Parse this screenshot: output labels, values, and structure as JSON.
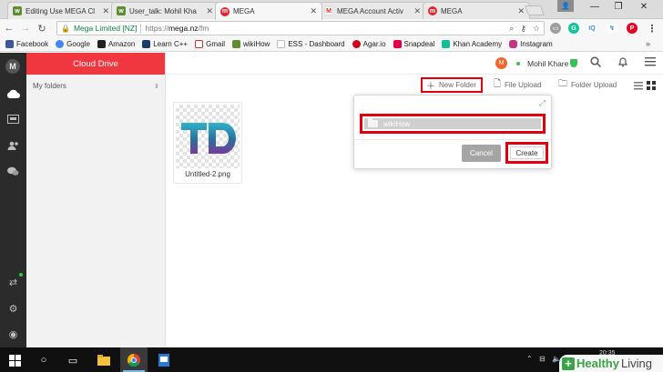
{
  "tabs": [
    {
      "title": "Editing Use MEGA Cl",
      "icon": "wikihow-icon"
    },
    {
      "title": "User_talk: Mohil Kha",
      "icon": "wikihow-icon"
    },
    {
      "title": "MEGA",
      "icon": "mega-icon"
    },
    {
      "title": "MEGA Account Activ",
      "icon": "gmail-icon"
    },
    {
      "title": "MEGA",
      "icon": "mega-icon"
    }
  ],
  "address": {
    "secure_label": "Mega Limited [NZ]",
    "url_prefix": "https://",
    "url_host": "mega.nz",
    "url_path": "/fm"
  },
  "bookmarks": [
    {
      "label": "Facebook",
      "color": "#3b5998"
    },
    {
      "label": "Google",
      "color": "#4285f4"
    },
    {
      "label": "Amazon",
      "color": "#222222"
    },
    {
      "label": "Learn C++",
      "color": "#1f3a6e"
    },
    {
      "label": "Gmail",
      "color": "#d93025"
    },
    {
      "label": "wikiHow",
      "color": "#5e8c31"
    },
    {
      "label": "ESS - Dashboard",
      "color": "#888888"
    },
    {
      "label": "Agar.io",
      "color": "#d0021b"
    },
    {
      "label": "Snapdeal",
      "color": "#e40046"
    },
    {
      "label": "Khan Academy",
      "color": "#14bf96"
    },
    {
      "label": "Instagram",
      "color": "#c13584"
    }
  ],
  "mega": {
    "section_title": "Cloud Drive",
    "folders_label": "My folders",
    "user_initial": "M",
    "username": "Mohil Khare",
    "actions": {
      "new_folder": "New Folder",
      "file_upload": "File Upload",
      "folder_upload": "Folder Upload"
    },
    "file": {
      "name": "Untitled-2.png",
      "thumb_text": "TD"
    },
    "dialog": {
      "folder_name": "wikiHow",
      "cancel": "Cancel",
      "create": "Create"
    }
  },
  "taskbar": {
    "clock": "20:35"
  },
  "watermark": {
    "plus": "+",
    "text_a": "Healthy",
    "text_b": "Living"
  },
  "colors": {
    "mega_red": "#f0373f",
    "highlight_red": "#e2000f",
    "rail": "#2b2b2b"
  }
}
